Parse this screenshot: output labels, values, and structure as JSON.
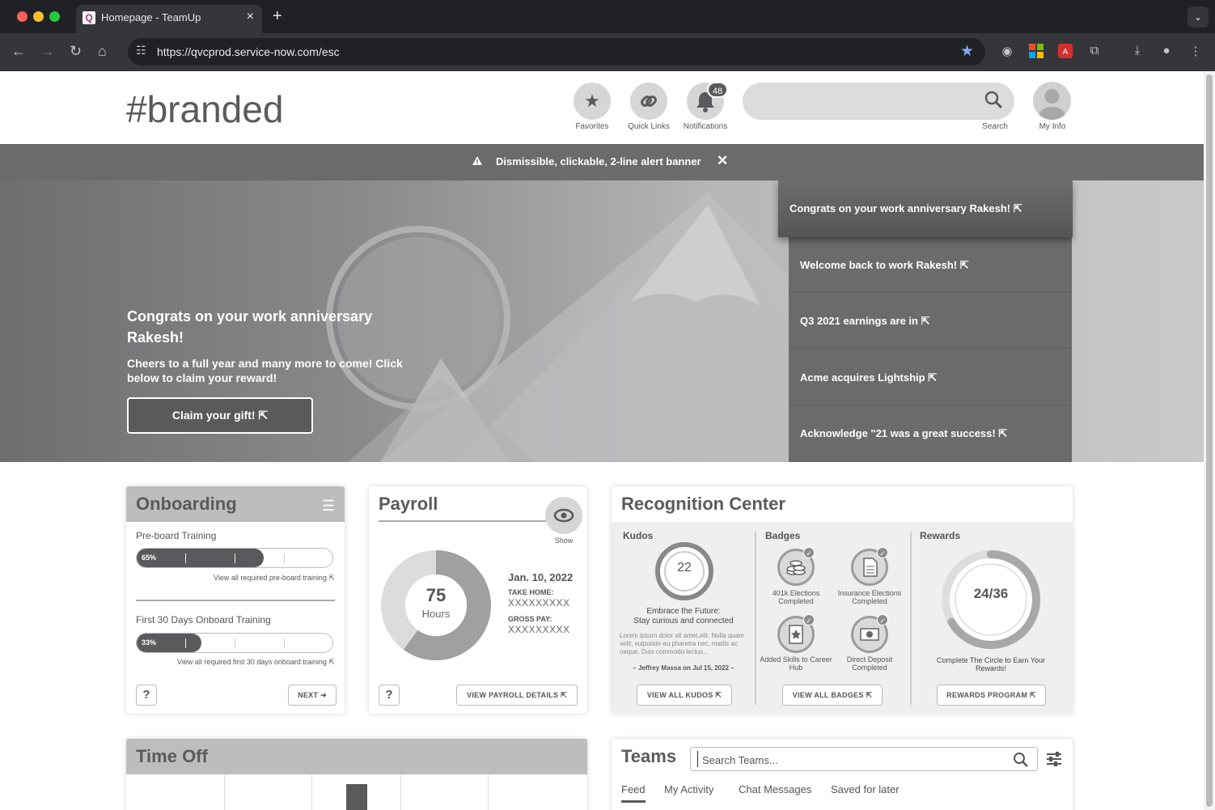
{
  "browser": {
    "tab_title": "Homepage - TeamUp",
    "url": "https://qvcprod.service-now.com/esc"
  },
  "header": {
    "brand": "#branded",
    "favorites_label": "Favorites",
    "quicklinks_label": "Quick Links",
    "notifications_label": "Notifications",
    "notifications_count": "48",
    "search_label": "Search",
    "myinfo_label": "My Info"
  },
  "alert": {
    "text": "Dismissible, clickable, 2-line alert banner"
  },
  "hero": {
    "title": "Congrats on your work anniversary Rakesh!",
    "subtitle": "Cheers to a full year and many more to come! Click below to claim your reward!",
    "button": "Claim your gift!",
    "news": [
      "Congrats on your work anniversary Rakesh!",
      "Welcome back to work Rakesh!",
      "Q3 2021 earnings are in",
      "Acme acquires Lightship",
      "Acknowledge \"21 was a great success!"
    ]
  },
  "onboarding": {
    "title": "Onboarding",
    "preboard_label": "Pre-board Training",
    "preboard_pct": "65%",
    "preboard_value": 0.65,
    "preboard_link": "View all required pre-board training",
    "first30_label": "First 30 Days Onboard Training",
    "first30_pct": "33%",
    "first30_value": 0.33,
    "first30_link": "View all required first 30 days onboard training",
    "help": "?",
    "next": "NEXT"
  },
  "payroll": {
    "title": "Payroll",
    "show": "Show",
    "hours": "75",
    "hours_label": "Hours",
    "date": "Jan. 10, 2022",
    "take_home_label": "TAKE HOME:",
    "take_home_value": "XXXXXXXXX",
    "gross_label": "GROSS PAY:",
    "gross_value": "XXXXXXXXX",
    "help": "?",
    "details": "VIEW PAYROLL DETAILS",
    "donut_fraction": 0.6
  },
  "recognition": {
    "title": "Recognition Center",
    "kudos_title": "Kudos",
    "kudos_count": "22",
    "kudos_headline1": "Embrace the Future:",
    "kudos_headline2": "Stay curious and connected",
    "kudos_body": "Lorem ipsum dolor sit amet,elit. Nulla quam velit, vulputate eu pharetra nec, mattis ac neque. Duis commodo lectus...",
    "kudos_author": "– Jeffrey Massa on Jul 15, 2022 –",
    "kudos_btn": "VIEW ALL KUDOS",
    "badges_title": "Badges",
    "badges": [
      "401k Elections Completed",
      "Insurance Elections Completed",
      "Added Skills to Career Hub",
      "Direct Deposit Completed"
    ],
    "badges_btn": "VIEW ALL BADGES",
    "rewards_title": "Rewards",
    "rewards_count": "24/36",
    "rewards_value": 0.667,
    "rewards_caption": "Complete The Circle to Earn Your Rewards!",
    "rewards_btn": "REWARDS PROGRAM"
  },
  "timeoff": {
    "title": "Time Off"
  },
  "teams": {
    "title": "Teams",
    "search_placeholder": "Search Teams...",
    "tabs": [
      "Feed",
      "My Activity",
      "Chat Messages",
      "Saved for later"
    ]
  }
}
